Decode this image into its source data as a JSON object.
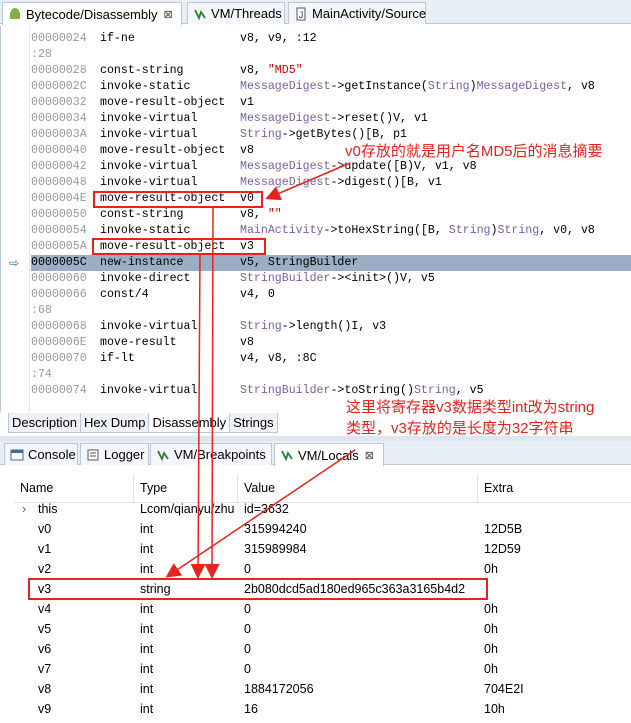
{
  "top_tabs": [
    {
      "label": "Bytecode/Disassembly",
      "close": "⊠"
    },
    {
      "label": "VM/Threads"
    },
    {
      "label": "MainActivity/Source"
    }
  ],
  "code_lines": [
    {
      "addr": "00000024",
      "op": "if-ne",
      "args": [
        [
          "v8, v9, :12",
          ""
        ]
      ]
    },
    {
      "addr": ":28",
      "op": "",
      "args": []
    },
    {
      "addr": "00000028",
      "op": "const-string",
      "args": [
        [
          "v8, ",
          ""
        ],
        [
          "\"MD5\"",
          "str"
        ]
      ]
    },
    {
      "addr": "0000002C",
      "op": "invoke-static",
      "args": [
        [
          "MessageDigest",
          "typ"
        ],
        [
          "->getInstance(",
          ""
        ],
        [
          "String",
          "typ"
        ],
        [
          ")",
          ""
        ],
        [
          "MessageDigest",
          "typ"
        ],
        [
          ", v8",
          ""
        ]
      ]
    },
    {
      "addr": "00000032",
      "op": "move-result-object",
      "args": [
        [
          "v1",
          ""
        ]
      ]
    },
    {
      "addr": "00000034",
      "op": "invoke-virtual",
      "args": [
        [
          "MessageDigest",
          "typ"
        ],
        [
          "->reset()V, v1",
          ""
        ]
      ]
    },
    {
      "addr": "0000003A",
      "op": "invoke-virtual",
      "args": [
        [
          "String",
          "typ"
        ],
        [
          "->getBytes()[B, p1",
          ""
        ]
      ]
    },
    {
      "addr": "00000040",
      "op": "move-result-object",
      "args": [
        [
          "v8",
          ""
        ]
      ]
    },
    {
      "addr": "00000042",
      "op": "invoke-virtual",
      "args": [
        [
          "MessageDigest",
          "typ"
        ],
        [
          "->update([B)V, v1, v8",
          ""
        ]
      ]
    },
    {
      "addr": "00000048",
      "op": "invoke-virtual",
      "args": [
        [
          "MessageDigest",
          "typ"
        ],
        [
          "->digest()[B, v1",
          ""
        ]
      ]
    },
    {
      "addr": "0000004E",
      "op": "move-result-object",
      "args": [
        [
          "v0",
          ""
        ]
      ]
    },
    {
      "addr": "00000050",
      "op": "const-string",
      "args": [
        [
          "v8, ",
          ""
        ],
        [
          "\"\"",
          "str"
        ]
      ]
    },
    {
      "addr": "00000054",
      "op": "invoke-static",
      "args": [
        [
          "MainActivity",
          "typ"
        ],
        [
          "->toHexString([B, ",
          ""
        ],
        [
          "String",
          "typ"
        ],
        [
          ")",
          ""
        ],
        [
          "String",
          "typ"
        ],
        [
          ", v0, v8",
          ""
        ]
      ]
    },
    {
      "addr": "0000005A",
      "op": "move-result-object",
      "args": [
        [
          "v3",
          ""
        ]
      ]
    },
    {
      "addr": "0000005C",
      "op": "new-instance",
      "args": [
        [
          "v5, StringBuilder",
          ""
        ]
      ]
    },
    {
      "addr": "00000060",
      "op": "invoke-direct",
      "args": [
        [
          "StringBuilder",
          "typ"
        ],
        [
          "-><init>()V, v5",
          ""
        ]
      ]
    },
    {
      "addr": "00000066",
      "op": "const/4",
      "args": [
        [
          "v4, 0",
          ""
        ]
      ]
    },
    {
      "addr": ":68",
      "op": "",
      "args": []
    },
    {
      "addr": "00000068",
      "op": "invoke-virtual",
      "args": [
        [
          "String",
          "typ"
        ],
        [
          "->length()I, v3",
          ""
        ]
      ]
    },
    {
      "addr": "0000006E",
      "op": "move-result",
      "args": [
        [
          "v8",
          ""
        ]
      ]
    },
    {
      "addr": "00000070",
      "op": "if-lt",
      "args": [
        [
          "v4, v8, :8C",
          ""
        ]
      ]
    },
    {
      "addr": ":74",
      "op": "",
      "args": []
    },
    {
      "addr": "00000074",
      "op": "invoke-virtual",
      "args": [
        [
          "StringBuilder",
          "typ"
        ],
        [
          "->toString()",
          ""
        ],
        [
          "String",
          "typ"
        ],
        [
          ", v5",
          ""
        ]
      ]
    }
  ],
  "current_line": 14,
  "bottom_tabs": [
    "Description",
    "Hex Dump",
    "Disassembly",
    "Strings"
  ],
  "lower_tabs": [
    {
      "label": "Console"
    },
    {
      "label": "Logger"
    },
    {
      "label": "VM/Breakpoints"
    },
    {
      "label": "VM/Locals",
      "close": "⊠"
    }
  ],
  "table": {
    "columns": [
      "Name",
      "Type",
      "Value",
      "Extra"
    ],
    "rows": [
      {
        "expander": "›",
        "name": "this",
        "type": "Lcom/qianyu/zhu",
        "value": "id=3632",
        "extra": ""
      },
      {
        "name": "v0",
        "type": "int",
        "value": "315994240",
        "extra": "12D5B"
      },
      {
        "name": "v1",
        "type": "int",
        "value": "315989984",
        "extra": "12D59"
      },
      {
        "name": "v2",
        "type": "int",
        "value": "0",
        "extra": "0h"
      },
      {
        "name": "v3",
        "type": "string",
        "value": "2b080dcd5ad180ed965c363a3165b4d2",
        "extra": ""
      },
      {
        "name": "v4",
        "type": "int",
        "value": "0",
        "extra": "0h"
      },
      {
        "name": "v5",
        "type": "int",
        "value": "0",
        "extra": "0h"
      },
      {
        "name": "v6",
        "type": "int",
        "value": "0",
        "extra": "0h"
      },
      {
        "name": "v7",
        "type": "int",
        "value": "0",
        "extra": "0h"
      },
      {
        "name": "v8",
        "type": "int",
        "value": "1884172056",
        "extra": "704E2I"
      },
      {
        "name": "v9",
        "type": "int",
        "value": "16",
        "extra": "10h"
      }
    ]
  },
  "annotations": {
    "v0_note": "v0存放的就是用户名MD5后的消息摘要",
    "v3_note_line1": "这里将寄存器v3数据类型int改为string",
    "v3_note_line2": "类型，v3存放的是长度为32字符串"
  },
  "colors": {
    "annotation": "#e8221c",
    "type_purple": "#7b5ea7",
    "string_red": "#d40000",
    "current_line": "#9aaec6"
  }
}
